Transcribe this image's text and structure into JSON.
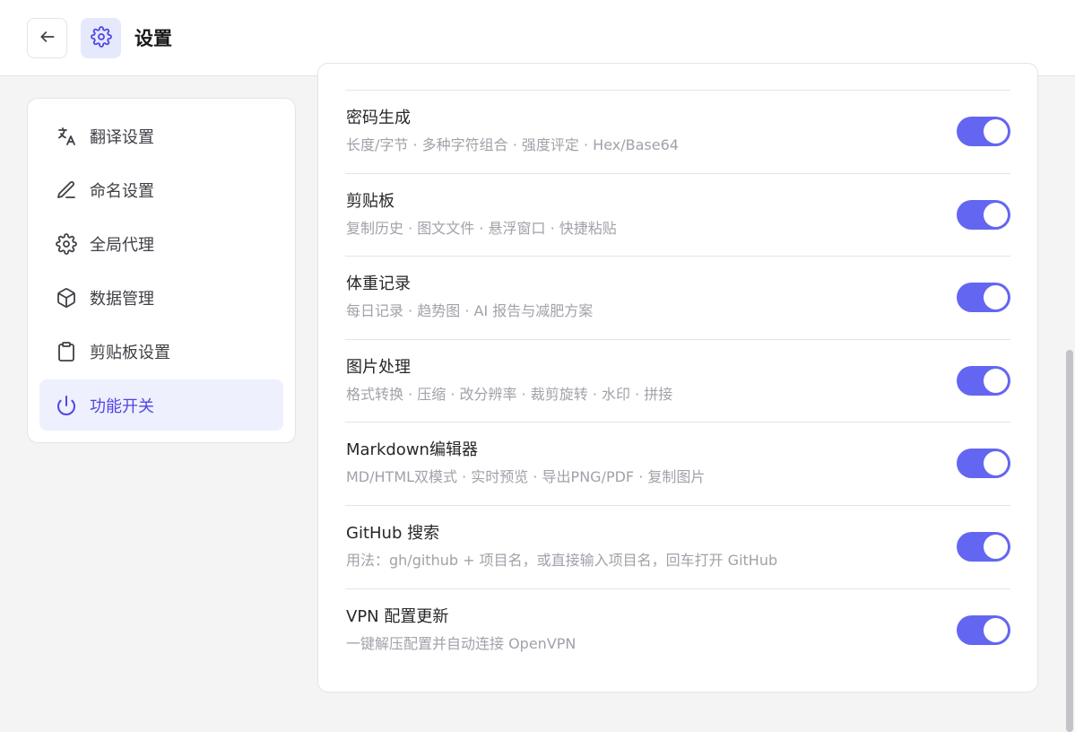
{
  "header": {
    "title": "设置",
    "back_icon": "arrow-left-icon",
    "logo_icon": "gear-icon"
  },
  "sidebar": {
    "items": [
      {
        "label": "翻译设置",
        "icon": "translate-icon",
        "active": false
      },
      {
        "label": "命名设置",
        "icon": "pencil-icon",
        "active": false
      },
      {
        "label": "全局代理",
        "icon": "gear-icon",
        "active": false
      },
      {
        "label": "数据管理",
        "icon": "cube-icon",
        "active": false
      },
      {
        "label": "剪贴板设置",
        "icon": "clipboard-icon",
        "active": false
      },
      {
        "label": "功能开关",
        "icon": "power-icon",
        "active": true
      }
    ]
  },
  "features": [
    {
      "title": "密码生成",
      "desc": "长度/字节 · 多种字符组合 · 强度评定 · Hex/Base64",
      "enabled": true
    },
    {
      "title": "剪贴板",
      "desc": "复制历史 · 图文文件 · 悬浮窗口 · 快捷粘贴",
      "enabled": true
    },
    {
      "title": "体重记录",
      "desc": "每日记录 · 趋势图 · AI 报告与减肥方案",
      "enabled": true
    },
    {
      "title": "图片处理",
      "desc": "格式转换 · 压缩 · 改分辨率 · 裁剪旋转 · 水印 · 拼接",
      "enabled": true
    },
    {
      "title": "Markdown编辑器",
      "desc": "MD/HTML双模式 · 实时预览 · 导出PNG/PDF · 复制图片",
      "enabled": true
    },
    {
      "title": "GitHub 搜索",
      "desc": "用法：gh/github + 项目名，或直接输入项目名，回车打开 GitHub",
      "enabled": true
    },
    {
      "title": "VPN 配置更新",
      "desc": "一键解压配置并自动连接 OpenVPN",
      "enabled": true
    }
  ],
  "colors": {
    "accent": "#6366f1",
    "active_bg": "#eef0fd",
    "active_text": "#4f46e5"
  }
}
